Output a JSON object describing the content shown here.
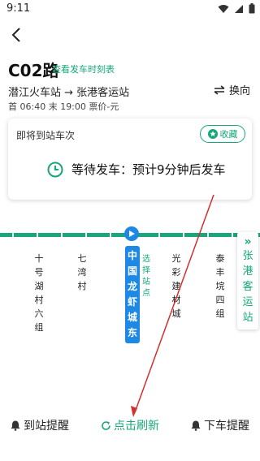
{
  "status_bar": {
    "time": "9:11"
  },
  "header": {
    "route_name": "C02路",
    "timetable_link": "查看发车时刻表",
    "direction": "潜江火车站 → 张港客运站",
    "switch_label": "换向",
    "times": "首 06:40  末 19:00  票价-元"
  },
  "card": {
    "title": "即将到站车次",
    "favorite_label": "收藏",
    "wait_text": "等待发车：预计9分钟后发车"
  },
  "stops": {
    "items": [
      "十号湖村六组",
      "七湾村",
      "中国龙虾城东",
      "光彩建材城",
      "泰丰垸四组"
    ],
    "select_label": "选择站点",
    "terminal": "张港客运站"
  },
  "bottom": {
    "arrive_label": "到站提醒",
    "refresh_label": "点击刷新",
    "alight_label": "下车提醒"
  },
  "colors": {
    "accent": "#16a779",
    "line": "#19a67a",
    "current": "#1e88e5",
    "annotation": "#d32f2f"
  }
}
